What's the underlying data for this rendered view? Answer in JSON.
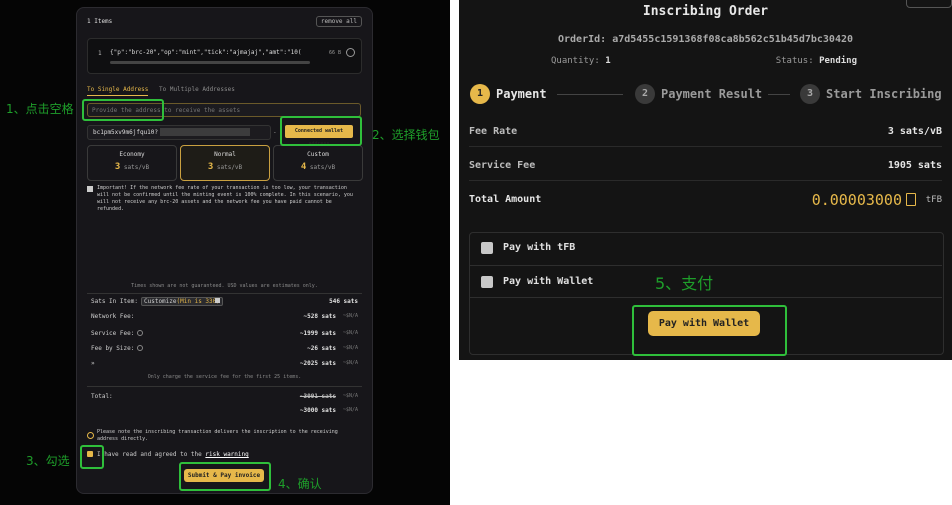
{
  "left": {
    "items_title": "1 Items",
    "remove_all": "remove all",
    "item_number": "1",
    "item_text": "{\"p\":\"brc-20\",\"op\":\"mint\",\"tick\":\"ajmajaj\",\"amt\":\"10(",
    "item_meta": "66 B",
    "tab_single": "To Single Address",
    "tab_multiple": "To Multiple Addresses",
    "address_placeholder": "Provide the address to receive the assets",
    "address_value": "bc1pm5xv9m6jfqu10?",
    "connected_wallet": "Connected wallet address",
    "fees": [
      {
        "name": "Economy",
        "value": "3",
        "unit": "sats/vB"
      },
      {
        "name": "Normal",
        "value": "3",
        "unit": "sats/vB"
      },
      {
        "name": "Custom",
        "value": "4",
        "unit": "sats/vB"
      }
    ],
    "warning": "Important! If the network fee rate of your transaction is too low, your transaction will not be confirmed until the minting event is 100% complete. In this scenario, you will not receive any brc-20 assets and the network fee you have paid cannot be refunded.",
    "times_note": "Times shown are not guaranteed. USD values are estimates only.",
    "sats_in_item_label": "Sats In Item:",
    "customize_label": "Customize",
    "customize_min": "(Min is 330)",
    "sats_in_item_value": "546 sats",
    "network_fee_label": "Network Fee:",
    "network_fee_value": "~528 sats",
    "service_fee_label": "Service Fee:",
    "service_fee_value": "~1999 sats",
    "fee_by_size_label": "Fee by Size:",
    "fee_by_size_value": "~26 sats",
    "arrow_label": "»",
    "subtotal_value": "~2025 sats",
    "usd_value": "~$N/A",
    "only_charge_note": "Only charge the service fee for the first 25 items.",
    "total_label": "Total:",
    "total_strike": "~3091 sats",
    "total_value": "~3000 sats",
    "notice": "Please note the inscribing transaction delivers the inscription to the receiving address directly.",
    "agree_text": "I have read and agreed to the",
    "risk_warning": "risk warning",
    "submit_label": "Submit & Pay invoice"
  },
  "annotations": {
    "a1": "1、点击空格",
    "a2": "2、选择钱包",
    "a3": "3、勾选",
    "a4": "4、确认",
    "a5": "5、支付"
  },
  "right": {
    "title": "Inscribing Order",
    "order_id_label": "OrderId:",
    "order_id": "a7d5455c1591368f08ca8b562c51b45d7bc30420",
    "quantity_label": "Quantity:",
    "quantity": "1",
    "status_label": "Status:",
    "status": "Pending",
    "steps": [
      {
        "num": "1",
        "label": "Payment"
      },
      {
        "num": "2",
        "label": "Payment Result"
      },
      {
        "num": "3",
        "label": "Start Inscribing"
      }
    ],
    "fee_rate_label": "Fee Rate",
    "fee_rate_value": "3 sats/vB",
    "service_fee_label": "Service Fee",
    "service_fee_value": "1905 sats",
    "total_amount_label": "Total Amount",
    "total_amount_value": "0.00003000",
    "total_amount_unit": "tFB",
    "pay_tfb": "Pay with tFB",
    "pay_wallet_option": "Pay with Wallet",
    "pay_wallet_button": "Pay with Wallet"
  },
  "colors": {
    "accent": "#e6b84a",
    "annotation": "#2fbf3b"
  }
}
